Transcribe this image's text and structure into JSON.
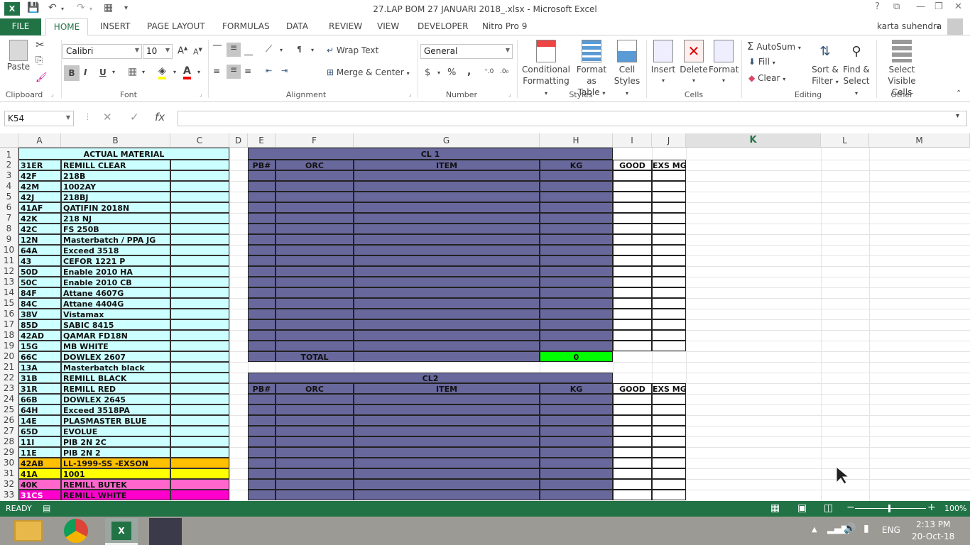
{
  "window": {
    "title": "27.LAP BOM 27 JANUARI 2018_.xlsx - Microsoft Excel"
  },
  "tabs": [
    "FILE",
    "HOME",
    "INSERT",
    "PAGE LAYOUT",
    "FORMULAS",
    "DATA",
    "REVIEW",
    "VIEW",
    "DEVELOPER",
    "Nitro Pro 9"
  ],
  "user": "karta suhendra",
  "ribbon": {
    "clipboard": {
      "paste": "Paste",
      "label": "Clipboard"
    },
    "font": {
      "name": "Calibri",
      "size": "10",
      "bold": "B",
      "italic": "I",
      "underline": "U",
      "label": "Font"
    },
    "alignment": {
      "wrap": "Wrap Text",
      "merge": "Merge & Center",
      "label": "Alignment"
    },
    "number": {
      "format": "General",
      "currency": "$",
      "percent": "%",
      "comma": ",",
      "label": "Number"
    },
    "styles": {
      "conditional": "Conditional",
      "conditional2": "Formatting",
      "format_as": "Format as",
      "format_as2": "Table",
      "cell": "Cell",
      "cell2": "Styles",
      "label": "Styles"
    },
    "cells": {
      "insert": "Insert",
      "delete": "Delete",
      "format": "Format",
      "label": "Cells"
    },
    "editing": {
      "autosum": "AutoSum",
      "fill": "Fill",
      "clear": "Clear",
      "sort": "Sort &",
      "sort2": "Filter",
      "find": "Find &",
      "find2": "Select",
      "label": "Editing"
    },
    "other": {
      "select": "Select",
      "select2": "Visible Cells",
      "label": "Other"
    }
  },
  "formula": {
    "namebox": "K54",
    "fx": "fx",
    "value": ""
  },
  "columns": [
    "A",
    "B",
    "C",
    "D",
    "E",
    "F",
    "G",
    "H",
    "I",
    "J",
    "K",
    "L",
    "M"
  ],
  "rows": [
    "1",
    "2",
    "3",
    "4",
    "5",
    "6",
    "7",
    "8",
    "9",
    "10",
    "11",
    "12",
    "13",
    "14",
    "15",
    "16",
    "17",
    "18",
    "19",
    "20",
    "21",
    "22",
    "23",
    "24",
    "25",
    "26",
    "27",
    "28",
    "29",
    "30",
    "31",
    "32",
    "33"
  ],
  "material": {
    "header": "ACTUAL MATERIAL",
    "items": [
      [
        "31ER",
        "REMILL CLEAR"
      ],
      [
        "42F",
        "218B"
      ],
      [
        "42M",
        "1002AY"
      ],
      [
        "42J",
        "218BJ"
      ],
      [
        "41AF",
        "QATIFIN 2018N"
      ],
      [
        "42K",
        "218 NJ"
      ],
      [
        "42C",
        "FS 250B"
      ],
      [
        "12N",
        "Masterbatch / PPA JG"
      ],
      [
        "64A",
        "Exceed 3518"
      ],
      [
        "43",
        "CEFOR 1221 P"
      ],
      [
        "50D",
        "Enable 2010 HA"
      ],
      [
        "50C",
        "Enable 2010 CB"
      ],
      [
        "84F",
        "Attane 4607G"
      ],
      [
        "84C",
        "Attane 4404G"
      ],
      [
        "38V",
        "Vistamax"
      ],
      [
        "85D",
        "SABIC 8415"
      ],
      [
        "42AD",
        "QAMAR FD18N"
      ],
      [
        "15G",
        "MB WHITE"
      ],
      [
        "66C",
        "DOWLEX 2607"
      ],
      [
        "13A",
        "Masterbatch black"
      ],
      [
        "31B",
        "REMILL BLACK"
      ],
      [
        "31R",
        "REMILL RED"
      ],
      [
        "66B",
        "DOWLEX 2645"
      ],
      [
        "64H",
        "Exceed 3518PA"
      ],
      [
        "14E",
        "PLASMASTER BLUE"
      ],
      [
        "65D",
        "EVOLUE"
      ],
      [
        "11I",
        "PIB 2N 2C"
      ],
      [
        "11E",
        "PIB 2N 2"
      ],
      [
        "42AB",
        "LL-1999-SS -EXSON"
      ],
      [
        "41A",
        "1001"
      ],
      [
        "40K",
        "REMILL BUTEK"
      ],
      [
        "31CS",
        "REMILL WHITE"
      ]
    ]
  },
  "cl1": {
    "title": "CL 1",
    "headers": [
      "PB#",
      "ORC",
      "ITEM",
      "KG",
      "GOOD",
      "EXS MG"
    ],
    "total_label": "TOTAL",
    "total_value": "0"
  },
  "cl2": {
    "title": "CL2",
    "headers": [
      "PB#",
      "ORC",
      "ITEM",
      "KG",
      "GOOD",
      "EXS MG"
    ]
  },
  "status": {
    "mode": "READY",
    "zoom": "100%"
  },
  "taskbar": {
    "lang": "ENG",
    "time": "2:13 PM",
    "date": "20-Oct-18"
  },
  "colors": {
    "excel_green": "#217346",
    "cyan": "#ccffff",
    "purple": "#69689c",
    "lime": "#00ff00",
    "orange": "#ffc000",
    "yellow": "#ffff00",
    "pink": "#ff66cc",
    "magenta": "#ff00cc"
  }
}
